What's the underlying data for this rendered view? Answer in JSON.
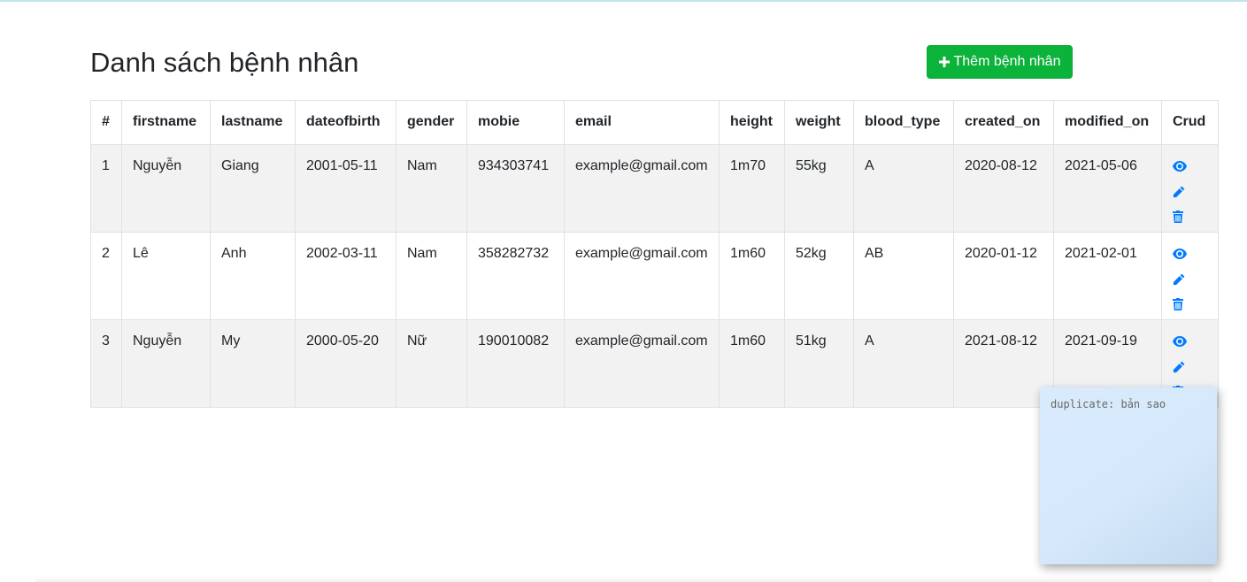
{
  "header": {
    "title": "Danh sách bệnh nhân",
    "add_button_label": "Thêm bệnh nhân"
  },
  "table": {
    "columns": [
      "#",
      "firstname",
      "lastname",
      "dateofbirth",
      "gender",
      "mobie",
      "email",
      "height",
      "weight",
      "blood_type",
      "created_on",
      "modified_on",
      "Crud"
    ],
    "rows": [
      {
        "id": "1",
        "firstname": "Nguyễn",
        "lastname": "Giang",
        "dateofbirth": "2001-05-11",
        "gender": "Nam",
        "mobie": "934303741",
        "email": "example@gmail.com",
        "height": "1m70",
        "weight": "55kg",
        "blood_type": "A",
        "created_on": "2020-08-12",
        "modified_on": "2021-05-06"
      },
      {
        "id": "2",
        "firstname": "Lê",
        "lastname": "Anh",
        "dateofbirth": "2002-03-11",
        "gender": "Nam",
        "mobie": "358282732",
        "email": "example@gmail.com",
        "height": "1m60",
        "weight": "52kg",
        "blood_type": "AB",
        "created_on": "2020-01-12",
        "modified_on": "2021-02-01"
      },
      {
        "id": "3",
        "firstname": "Nguyễn",
        "lastname": "My",
        "dateofbirth": "2000-05-20",
        "gender": "Nữ",
        "mobie": "190010082",
        "email": "example@gmail.com",
        "height": "1m60",
        "weight": "51kg",
        "blood_type": "A",
        "created_on": "2021-08-12",
        "modified_on": "2021-09-19"
      }
    ],
    "row_actions": [
      "eye-icon",
      "pencil-icon",
      "trash-icon"
    ]
  },
  "sticky_note": {
    "text": "duplicate: bản sao"
  },
  "colors": {
    "add_button": "#0bb33a",
    "action_icon": "#007bff",
    "striped_row": "#f2f2f2",
    "sticky_note": "#d8ebfc"
  }
}
